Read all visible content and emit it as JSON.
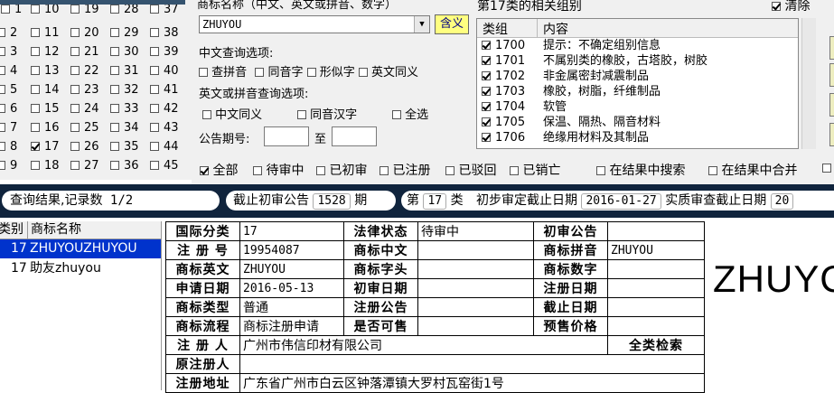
{
  "class_grid": {
    "rows": [
      [
        {
          "n": "2"
        },
        {
          "n": "11"
        },
        {
          "n": "20"
        },
        {
          "n": "29"
        },
        {
          "n": "38"
        }
      ],
      [
        {
          "n": "3"
        },
        {
          "n": "12"
        },
        {
          "n": "21"
        },
        {
          "n": "30"
        },
        {
          "n": "39"
        }
      ],
      [
        {
          "n": "4"
        },
        {
          "n": "13"
        },
        {
          "n": "22"
        },
        {
          "n": "31"
        },
        {
          "n": "40"
        }
      ],
      [
        {
          "n": "5"
        },
        {
          "n": "14"
        },
        {
          "n": "23"
        },
        {
          "n": "32"
        },
        {
          "n": "41"
        }
      ],
      [
        {
          "n": "6"
        },
        {
          "n": "15"
        },
        {
          "n": "24"
        },
        {
          "n": "33"
        },
        {
          "n": "42"
        }
      ],
      [
        {
          "n": "7"
        },
        {
          "n": "16"
        },
        {
          "n": "25"
        },
        {
          "n": "34"
        },
        {
          "n": "43"
        }
      ],
      [
        {
          "n": "8"
        },
        {
          "n": "17",
          "checked": true
        },
        {
          "n": "26"
        },
        {
          "n": "35"
        },
        {
          "n": "44"
        }
      ],
      [
        {
          "n": "9"
        },
        {
          "n": "18"
        },
        {
          "n": "27"
        },
        {
          "n": "36"
        },
        {
          "n": "45"
        }
      ]
    ],
    "top_row": [
      "1",
      "10",
      "19",
      "28",
      "37"
    ]
  },
  "query": {
    "name_label": "商标名称（中文、英文或拼音、数字）",
    "name_value": "ZHUYOU",
    "hanyi_button": "含义",
    "cn_options_label": "中文查询选项:",
    "cn_options": [
      "查拼音",
      "同音字",
      "形似字",
      "英文同义"
    ],
    "en_options_label": "英文或拼音查询选项:",
    "en_options": [
      "中文同义",
      "同音汉字",
      "全选"
    ],
    "period_label": "公告期号:",
    "period_to": "至"
  },
  "groups": {
    "title": "第17类的相关组别",
    "clear_label": "清除",
    "col_group": "类组",
    "col_content": "内容",
    "rows": [
      {
        "code": "1700",
        "desc": "提示：不确定组别信息"
      },
      {
        "code": "1701",
        "desc": "不属别类的橡胶，古塔胶，树胶"
      },
      {
        "code": "1702",
        "desc": "非金属密封减震制品"
      },
      {
        "code": "1703",
        "desc": "橡胶，树脂，纤维制品"
      },
      {
        "code": "1704",
        "desc": "软管"
      },
      {
        "code": "1705",
        "desc": "保温、隔热、隔音材料"
      },
      {
        "code": "1706",
        "desc": "绝缘用材料及其制品"
      }
    ]
  },
  "filters": {
    "items": [
      "全部",
      "待审中",
      "已初审",
      "已注册",
      "已驳回",
      "已销亡"
    ],
    "search_in_results": "在结果中搜索",
    "merge_in_results": "在结果中合并"
  },
  "status": {
    "result_label": "查询结果,记录数",
    "result_count": "1/2",
    "deadline_label": "截止初审公告",
    "deadline_value": "1528",
    "deadline_unit": "期",
    "class_prefix": "第",
    "class_value": "17",
    "class_suffix": "类",
    "prelim_label": "初步审定截止日期",
    "prelim_value": "2016-01-27",
    "substantive_label": "实质审查截止日期",
    "substantive_value": "20"
  },
  "results": {
    "col_class": "类别",
    "col_name": "商标名称",
    "rows": [
      {
        "cls": "17",
        "name": "ZHUYOUZHUYOU",
        "selected": true
      },
      {
        "cls": "17",
        "name": "助友zhuyou",
        "selected": false
      }
    ]
  },
  "detail": {
    "intl_class_k": "国际分类",
    "intl_class_v": "17",
    "legal_status_k": "法律状态",
    "legal_status_v": "待审中",
    "prelim_notice_k": "初审公告",
    "prelim_notice_v": "",
    "reg_no_k": "注 册 号",
    "reg_no_v": "19954087",
    "cn_k": "商标中文",
    "cn_v": "",
    "pinyin_k": "商标拼音",
    "pinyin_v": "ZHUYOU",
    "en_k": "商标英文",
    "en_v": "ZHUYOU",
    "head_k": "商标字头",
    "head_v": "",
    "digit_k": "商标数字",
    "digit_v": "",
    "apply_date_k": "申请日期",
    "apply_date_v": "2016-05-13",
    "prelim_date_k": "初审日期",
    "prelim_date_v": "",
    "reg_date_k": "注册日期",
    "reg_date_v": "",
    "type_k": "商标类型",
    "type_v": "普通",
    "reg_notice_k": "注册公告",
    "reg_notice_v": "",
    "deadline_date_k": "截止日期",
    "deadline_date_v": "",
    "flow_k": "商标流程",
    "flow_v": "商标注册申请",
    "sellable_k": "是否可售",
    "sellable_v": "",
    "presale_k": "预售价格",
    "presale_v": "",
    "registrant_k": "注 册 人",
    "registrant_v": "广州市伟信印材有限公司",
    "all_search": "全类检索",
    "orig_registrant_k": "原注册人",
    "orig_registrant_v": "",
    "address_k": "注册地址",
    "address_v": "广东省广州市白云区钟落潭镇大罗村瓦窑街1号"
  },
  "preview_name": "ZHUYOU"
}
